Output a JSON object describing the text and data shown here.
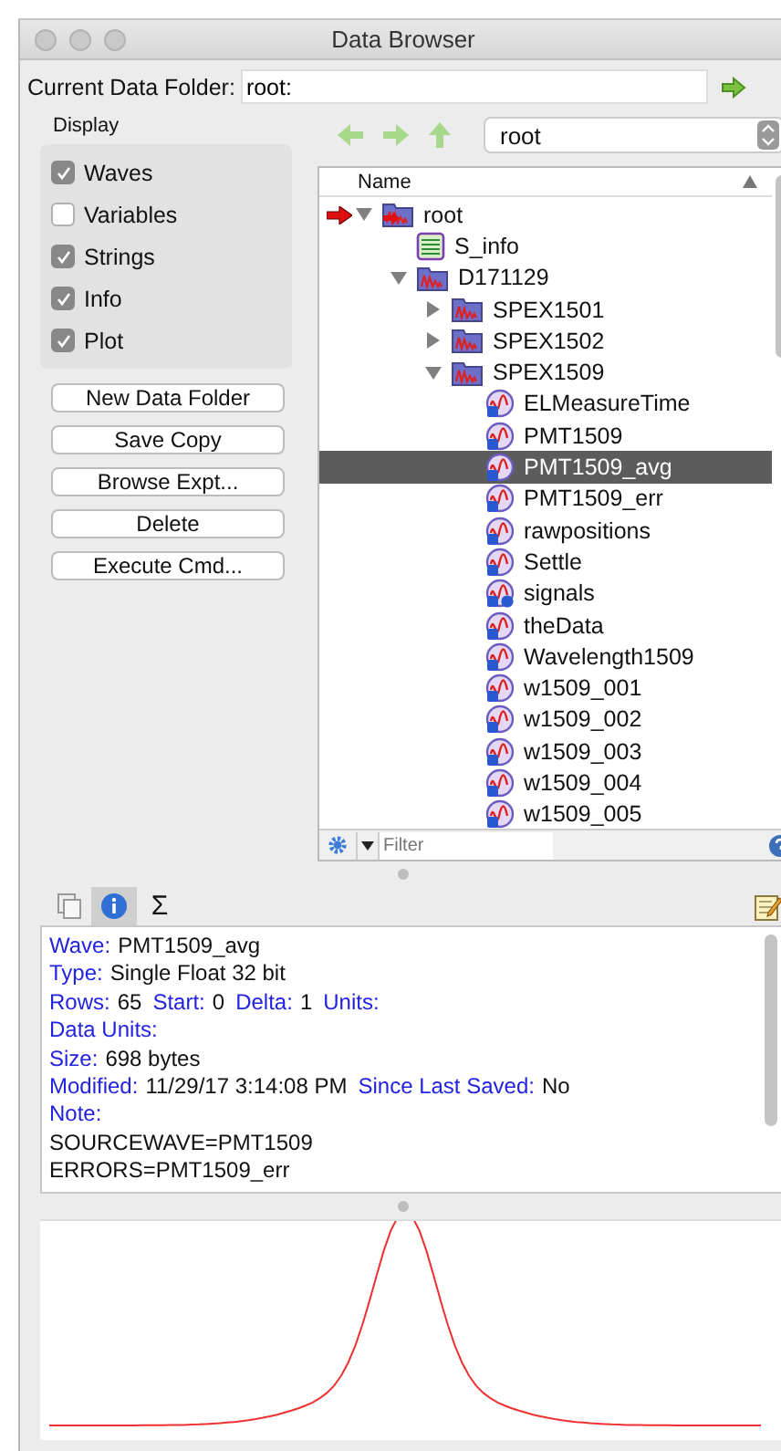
{
  "window": {
    "title": "Data Browser"
  },
  "current_folder": {
    "label": "Current Data Folder:",
    "value": "root:"
  },
  "display": {
    "title": "Display",
    "options": [
      {
        "label": "Waves",
        "checked": true
      },
      {
        "label": "Variables",
        "checked": false
      },
      {
        "label": "Strings",
        "checked": true
      },
      {
        "label": "Info",
        "checked": true
      },
      {
        "label": "Plot",
        "checked": true
      }
    ]
  },
  "buttons": [
    "New Data Folder",
    "Save Copy",
    "Browse Expt...",
    "Delete",
    "Execute Cmd..."
  ],
  "folder_popup": {
    "value": "root"
  },
  "tree": {
    "column": "Name",
    "items": [
      {
        "name": "root",
        "kind": "folder",
        "current": true,
        "expanded": true,
        "selected": false,
        "children": [
          {
            "name": "S_info",
            "kind": "text",
            "selected": false
          },
          {
            "name": "D171129",
            "kind": "folder",
            "current": false,
            "expanded": true,
            "selected": false,
            "children": [
              {
                "name": "SPEX1501",
                "kind": "folder",
                "current": false,
                "expanded": false,
                "selected": false
              },
              {
                "name": "SPEX1502",
                "kind": "folder",
                "current": false,
                "expanded": false,
                "selected": false
              },
              {
                "name": "SPEX1509",
                "kind": "folder",
                "current": false,
                "expanded": true,
                "selected": false,
                "children": [
                  {
                    "name": "ELMeasureTime",
                    "kind": "wave",
                    "selected": false
                  },
                  {
                    "name": "PMT1509",
                    "kind": "wave",
                    "selected": false
                  },
                  {
                    "name": "PMT1509_avg",
                    "kind": "wave",
                    "selected": true
                  },
                  {
                    "name": "PMT1509_err",
                    "kind": "wave",
                    "selected": false
                  },
                  {
                    "name": "rawpositions",
                    "kind": "wave",
                    "selected": false
                  },
                  {
                    "name": "Settle",
                    "kind": "wave",
                    "selected": false
                  },
                  {
                    "name": "signals",
                    "kind": "textwave",
                    "selected": false
                  },
                  {
                    "name": "theData",
                    "kind": "wave",
                    "selected": false
                  },
                  {
                    "name": "Wavelength1509",
                    "kind": "wave",
                    "selected": false
                  },
                  {
                    "name": "w1509_001",
                    "kind": "wave",
                    "selected": false
                  },
                  {
                    "name": "w1509_002",
                    "kind": "wave",
                    "selected": false
                  },
                  {
                    "name": "w1509_003",
                    "kind": "wave",
                    "selected": false
                  },
                  {
                    "name": "w1509_004",
                    "kind": "wave",
                    "selected": false
                  },
                  {
                    "name": "w1509_005",
                    "kind": "wave",
                    "selected": false
                  }
                ]
              }
            ]
          }
        ]
      }
    ]
  },
  "filter": {
    "placeholder": "Filter"
  },
  "info_tabs": [
    {
      "kind": "copy",
      "selected": false
    },
    {
      "kind": "info",
      "selected": true
    },
    {
      "kind": "sigma",
      "selected": false
    }
  ],
  "sigma": "Σ",
  "info_lines": [
    [
      {
        "kind": "label",
        "text": "Wave:"
      },
      {
        "kind": "value",
        "text": "PMT1509_avg"
      }
    ],
    [
      {
        "kind": "label",
        "text": "Type:"
      },
      {
        "kind": "value",
        "text": "Single Float 32 bit"
      }
    ],
    [
      {
        "kind": "label",
        "text": "Rows:"
      },
      {
        "kind": "value",
        "text": "65"
      },
      {
        "kind": "label",
        "text": "Start:"
      },
      {
        "kind": "value",
        "text": "0"
      },
      {
        "kind": "label",
        "text": "Delta:"
      },
      {
        "kind": "value",
        "text": "1"
      },
      {
        "kind": "label",
        "text": "Units:"
      }
    ],
    [
      {
        "kind": "label",
        "text": "Data Units:"
      }
    ],
    [
      {
        "kind": "label",
        "text": "Size:"
      },
      {
        "kind": "value",
        "text": "698 bytes"
      }
    ],
    [
      {
        "kind": "label",
        "text": "Modified:"
      },
      {
        "kind": "value",
        "text": "11/29/17 3:14:08 PM"
      },
      {
        "kind": "label",
        "text": "Since Last Saved:"
      },
      {
        "kind": "value",
        "text": "No"
      }
    ],
    [
      {
        "kind": "label",
        "text": "Note:"
      }
    ],
    [
      {
        "kind": "value",
        "text": "SOURCEWAVE=PMT1509"
      }
    ],
    [
      {
        "kind": "value",
        "text": "ERRORS=PMT1509_err"
      }
    ]
  ]
}
